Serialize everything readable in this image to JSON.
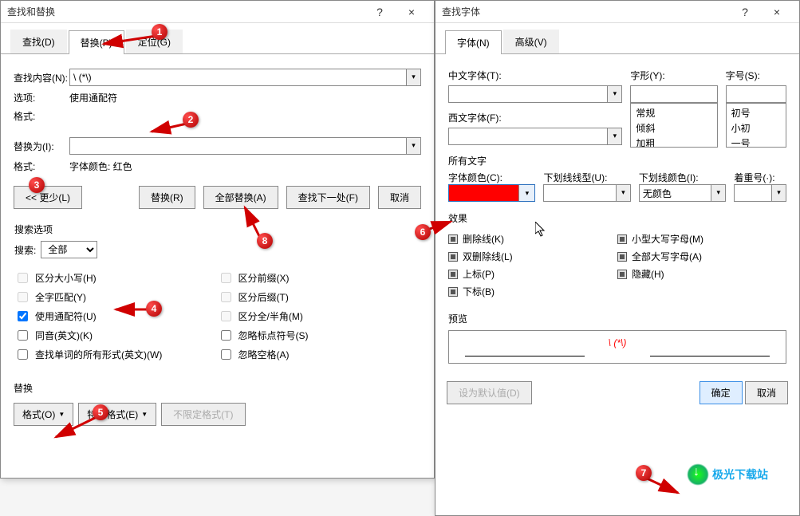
{
  "dialogLeft": {
    "title": "查找和替换",
    "tabs": {
      "find": "查找(D)",
      "replace": "替换(P)",
      "goto": "定位(G)"
    },
    "findLabel": "查找内容(N):",
    "findValue": "\\ (*\\)",
    "optionsLabel": "选项:",
    "optionsValue": "使用通配符",
    "formatLabel1": "格式:",
    "replaceLabel": "替换为(I):",
    "replaceValue": "",
    "formatLabel2": "格式:",
    "formatValue2": "字体颜色: 红色",
    "lessBtn": "<< 更少(L)",
    "replaceBtn": "替换(R)",
    "replaceAllBtn": "全部替换(A)",
    "findNextBtn": "查找下一处(F)",
    "cancelBtn": "取消",
    "searchOptsTitle": "搜索选项",
    "searchDirLabel": "搜索:",
    "searchDirValue": "全部",
    "chk": {
      "matchCase": "区分大小写(H)",
      "wholeWord": "全字匹配(Y)",
      "wildcard": "使用通配符(U)",
      "soundsLike": "同音(英文)(K)",
      "allForms": "查找单词的所有形式(英文)(W)",
      "prefix": "区分前缀(X)",
      "suffix": "区分后缀(T)",
      "fullHalf": "区分全/半角(M)",
      "ignorePunct": "忽略标点符号(S)",
      "ignoreSpace": "忽略空格(A)"
    },
    "replaceFooterTitle": "替换",
    "formatBtn": "格式(O)",
    "specialBtn": "特殊格式(E)",
    "noFormatBtn": "不限定格式(T)"
  },
  "dialogRight": {
    "title": "查找字体",
    "tabs": {
      "font": "字体(N)",
      "advanced": "高级(V)"
    },
    "labels": {
      "cnFont": "中文字体(T):",
      "westFont": "西文字体(F):",
      "fontStyle": "字形(Y):",
      "fontSize": "字号(S):",
      "allText": "所有文字",
      "fontColor": "字体颜色(C):",
      "underlineType": "下划线线型(U):",
      "underlineColor": "下划线颜色(I):",
      "emphasis": "着重号(·):",
      "noColor": "无颜色",
      "effects": "效果",
      "preview": "预览"
    },
    "styleList": [
      "常规",
      "倾斜",
      "加粗"
    ],
    "sizeList": [
      "初号",
      "小初",
      "一号"
    ],
    "effects": {
      "strike": "删除线(K)",
      "dblStrike": "双删除线(L)",
      "superscript": "上标(P)",
      "subscript": "下标(B)",
      "smallCaps": "小型大写字母(M)",
      "allCaps": "全部大写字母(A)",
      "hidden": "隐藏(H)"
    },
    "previewText": "\\ (*\\)",
    "setDefaultBtn": "设为默认值(D)",
    "okBtn": "确定",
    "cancelBtn": "取消"
  },
  "watermark": "极光下载站"
}
